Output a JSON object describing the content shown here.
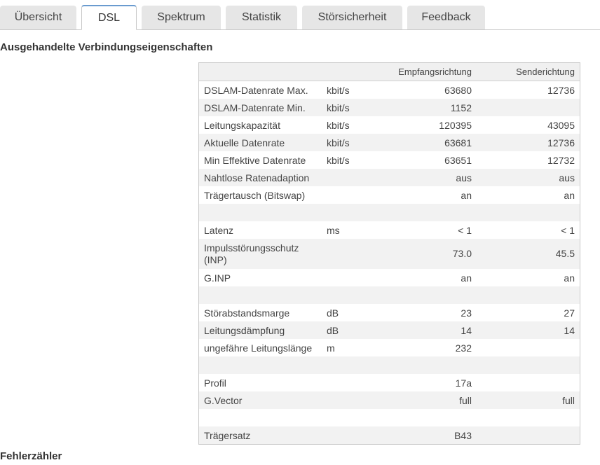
{
  "tabs": [
    {
      "label": "Übersicht"
    },
    {
      "label": "DSL"
    },
    {
      "label": "Spektrum"
    },
    {
      "label": "Statistik"
    },
    {
      "label": "Störsicherheit"
    },
    {
      "label": "Feedback"
    }
  ],
  "active_tab": "DSL",
  "section1_title": "Ausgehandelte Verbindungseigenschaften",
  "section2_title": "Fehlerzähler",
  "table": {
    "header": {
      "down": "Empfangsrichtung",
      "up": "Senderichtung"
    },
    "rows": [
      {
        "label": "DSLAM-Datenrate Max.",
        "unit": "kbit/s",
        "down": "63680",
        "up": "12736"
      },
      {
        "label": "DSLAM-Datenrate Min.",
        "unit": "kbit/s",
        "down": "1152",
        "up": ""
      },
      {
        "label": "Leitungskapazität",
        "unit": "kbit/s",
        "down": "120395",
        "up": "43095"
      },
      {
        "label": "Aktuelle Datenrate",
        "unit": "kbit/s",
        "down": "63681",
        "up": "12736"
      },
      {
        "label": "Min Effektive Datenrate",
        "unit": "kbit/s",
        "down": "63651",
        "up": "12732"
      },
      {
        "label": "Nahtlose Ratenadaption",
        "unit": "",
        "down": "aus",
        "up": "aus"
      },
      {
        "label": "Trägertausch (Bitswap)",
        "unit": "",
        "down": "an",
        "up": "an"
      },
      {
        "label": "",
        "unit": "",
        "down": "",
        "up": ""
      },
      {
        "label": "Latenz",
        "unit": "ms",
        "down": "< 1",
        "up": "< 1"
      },
      {
        "label": "Impulsstörungsschutz (INP)",
        "unit": "",
        "down": "73.0",
        "up": "45.5"
      },
      {
        "label": "G.INP",
        "unit": "",
        "down": "an",
        "up": "an"
      },
      {
        "label": "",
        "unit": "",
        "down": "",
        "up": ""
      },
      {
        "label": "Störabstandsmarge",
        "unit": "dB",
        "down": "23",
        "up": "27"
      },
      {
        "label": "Leitungsdämpfung",
        "unit": "dB",
        "down": "14",
        "up": "14"
      },
      {
        "label": "ungefähre Leitungslänge",
        "unit": "m",
        "down": "232",
        "up": ""
      },
      {
        "label": "",
        "unit": "",
        "down": "",
        "up": ""
      },
      {
        "label": "Profil",
        "unit": "",
        "down": "17a",
        "up": ""
      },
      {
        "label": "G.Vector",
        "unit": "",
        "down": "full",
        "up": "full"
      },
      {
        "label": "",
        "unit": "",
        "down": "",
        "up": ""
      },
      {
        "label": "Trägersatz",
        "unit": "",
        "down": "B43",
        "up": ""
      }
    ]
  }
}
